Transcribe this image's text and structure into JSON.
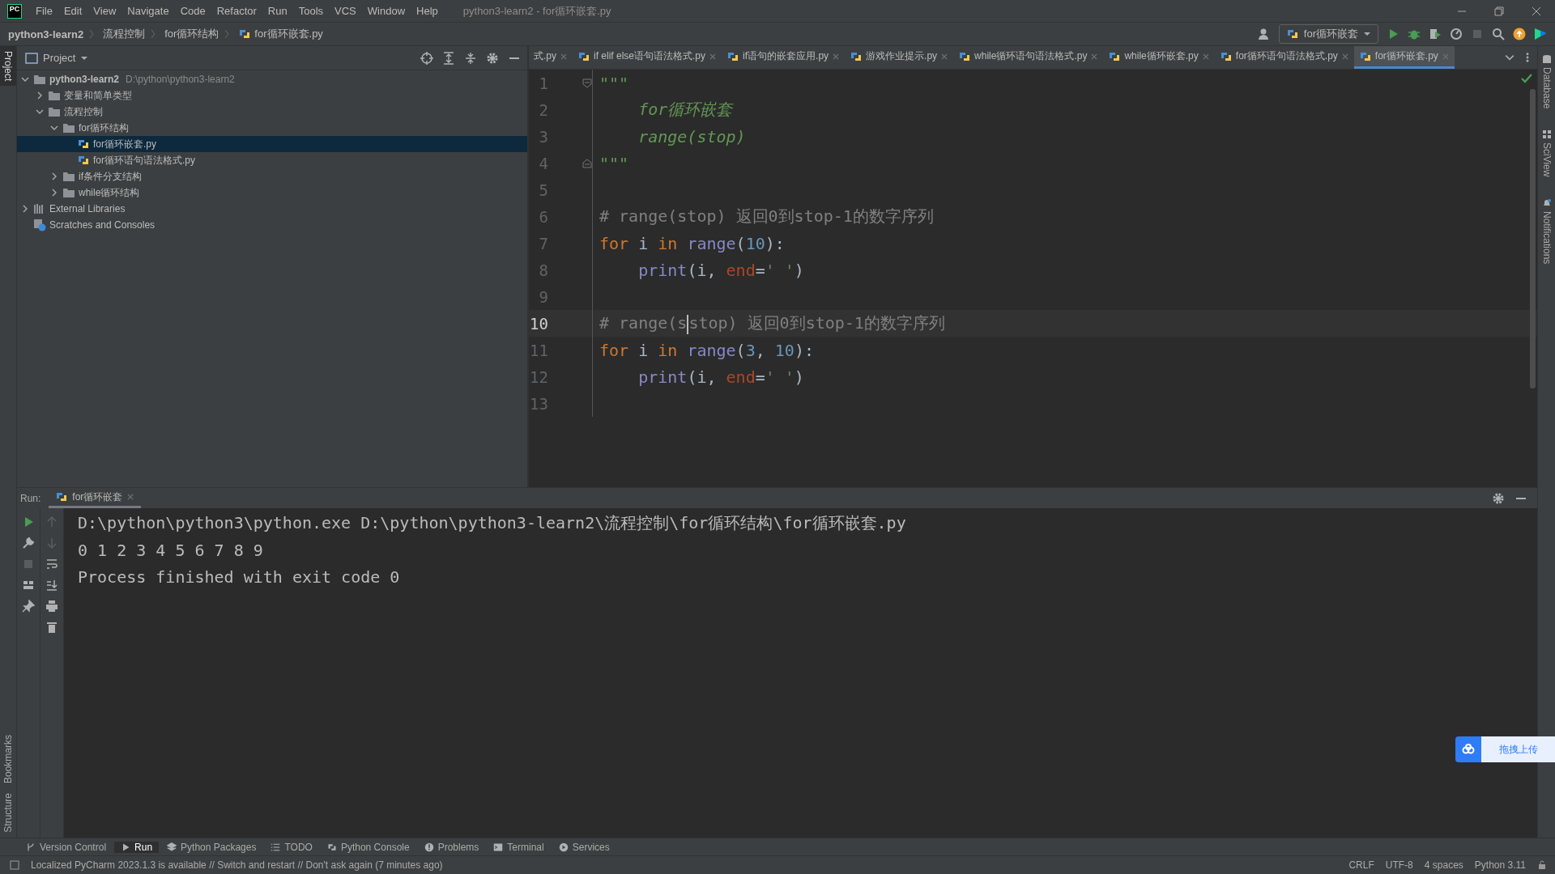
{
  "window": {
    "logo": "PC",
    "title": "python3-learn2 - for循环嵌套.py"
  },
  "menu": [
    "File",
    "Edit",
    "View",
    "Navigate",
    "Code",
    "Refactor",
    "Run",
    "Tools",
    "VCS",
    "Window",
    "Help"
  ],
  "breadcrumbs": [
    "python3-learn2",
    "流程控制",
    "for循环结构",
    "for循环嵌套.py"
  ],
  "run_config": "for循环嵌套",
  "left_strip": [
    {
      "label": "Project",
      "selected": true
    },
    {
      "label": "Bookmarks",
      "selected": false
    },
    {
      "label": "Structure",
      "selected": false
    }
  ],
  "right_strip": [
    {
      "label": "Database",
      "kind": "database"
    },
    {
      "label": "SciView",
      "kind": "sciview"
    },
    {
      "label": "Notifications",
      "kind": "notifications"
    }
  ],
  "project": {
    "title": "Project",
    "tree": [
      {
        "kind": "folder",
        "label": "python3-learn2",
        "path": "D:\\python\\python3-learn2",
        "expanded": true,
        "selected": false,
        "children": [
          {
            "kind": "folder",
            "label": "变量和简单类型",
            "expanded": false,
            "selected": false
          },
          {
            "kind": "folder",
            "label": "流程控制",
            "expanded": true,
            "selected": false,
            "children": [
              {
                "kind": "folder",
                "label": "for循环结构",
                "expanded": true,
                "selected": false,
                "children": [
                  {
                    "kind": "file",
                    "label": "for循环嵌套.py",
                    "selected": true
                  },
                  {
                    "kind": "file",
                    "label": "for循环语句语法格式.py",
                    "selected": false
                  }
                ]
              },
              {
                "kind": "folder",
                "label": "if条件分支结构",
                "expanded": false,
                "selected": false
              },
              {
                "kind": "folder",
                "label": "while循环结构",
                "expanded": false,
                "selected": false
              }
            ]
          }
        ]
      },
      {
        "kind": "library",
        "label": "External Libraries",
        "expanded": false,
        "selected": false
      },
      {
        "kind": "scratches",
        "label": "Scratches and Consoles",
        "selected": false
      }
    ]
  },
  "editor": {
    "tabs": [
      {
        "label": "式.py",
        "selected": false
      },
      {
        "label": "if elif else语句语法格式.py",
        "selected": false
      },
      {
        "label": "if语句的嵌套应用.py",
        "selected": false
      },
      {
        "label": "游戏作业提示.py",
        "selected": false
      },
      {
        "label": "while循环语句语法格式.py",
        "selected": false
      },
      {
        "label": "while循环嵌套.py",
        "selected": false
      },
      {
        "label": "for循环语句语法格式.py",
        "selected": false
      },
      {
        "label": "for循环嵌套.py",
        "selected": true
      }
    ],
    "lines": [
      {
        "number": "1",
        "current": false,
        "fold_open": true,
        "tokens": [
          {
            "kind": "docstring",
            "text": "\"\"\""
          }
        ]
      },
      {
        "number": "2",
        "current": false,
        "tokens": [
          {
            "kind": "docstring",
            "text": "    for循环嵌套"
          }
        ]
      },
      {
        "number": "3",
        "current": false,
        "tokens": [
          {
            "kind": "docstring",
            "text": "    range(stop)"
          }
        ]
      },
      {
        "number": "4",
        "current": false,
        "fold_close": true,
        "tokens": [
          {
            "kind": "docstring",
            "text": "\"\"\""
          }
        ]
      },
      {
        "number": "5",
        "current": false
      },
      {
        "number": "6",
        "current": false,
        "tokens": [
          {
            "kind": "comment",
            "text": "# range(stop) 返回0到stop-1的数字序列"
          }
        ]
      },
      {
        "number": "7",
        "current": false,
        "tokens": [
          {
            "kind": "keyword",
            "text": "for"
          },
          {
            "kind": "plain",
            "text": " i "
          },
          {
            "kind": "keyword",
            "text": "in"
          },
          {
            "kind": "builtin",
            "text": " range"
          },
          {
            "kind": "plain",
            "text": "("
          },
          {
            "kind": "number",
            "text": "10"
          },
          {
            "kind": "plain",
            "text": "):"
          }
        ]
      },
      {
        "number": "8",
        "current": false,
        "tokens": [
          {
            "kind": "builtin",
            "text": "    print"
          },
          {
            "kind": "plain",
            "text": "(i, "
          },
          {
            "kind": "param",
            "text": "end"
          },
          {
            "kind": "plain",
            "text": "="
          },
          {
            "kind": "string",
            "text": "' '"
          },
          {
            "kind": "plain",
            "text": ")"
          }
        ]
      },
      {
        "number": "9",
        "current": false
      },
      {
        "number": "10",
        "current": true,
        "tokens": [
          {
            "kind": "comment",
            "text": "# range(s"
          },
          {
            "kind": "caret"
          },
          {
            "kind": "comment",
            "text": "stop) 返回0到stop-1的数字序列"
          }
        ]
      },
      {
        "number": "11",
        "current": false,
        "tokens": [
          {
            "kind": "keyword",
            "text": "for"
          },
          {
            "kind": "plain",
            "text": " i "
          },
          {
            "kind": "keyword",
            "text": "in"
          },
          {
            "kind": "builtin",
            "text": " range"
          },
          {
            "kind": "plain",
            "text": "("
          },
          {
            "kind": "number",
            "text": "3"
          },
          {
            "kind": "plain",
            "text": ", "
          },
          {
            "kind": "number",
            "text": "10"
          },
          {
            "kind": "plain",
            "text": "):"
          }
        ]
      },
      {
        "number": "12",
        "current": false,
        "tokens": [
          {
            "kind": "builtin",
            "text": "    print"
          },
          {
            "kind": "plain",
            "text": "(i, "
          },
          {
            "kind": "param",
            "text": "end"
          },
          {
            "kind": "plain",
            "text": "="
          },
          {
            "kind": "string",
            "text": "' '"
          },
          {
            "kind": "plain",
            "text": ")"
          }
        ]
      },
      {
        "number": "13",
        "current": false
      }
    ]
  },
  "run": {
    "label": "Run:",
    "tabs": [
      {
        "label": "for循环嵌套",
        "selected": true
      }
    ],
    "toolbar": [
      {
        "kind": "rerun",
        "disabled": false
      },
      {
        "kind": "wrench",
        "disabled": false
      },
      {
        "kind": "stop",
        "disabled": true
      },
      {
        "kind": "layout",
        "disabled": false
      },
      {
        "kind": "pin",
        "disabled": false
      }
    ],
    "toolbar_2": [
      {
        "kind": "up",
        "disabled": true
      },
      {
        "kind": "down",
        "disabled": true
      },
      {
        "kind": "wrap",
        "disabled": false
      },
      {
        "kind": "scroll-end",
        "disabled": false
      },
      {
        "kind": "print",
        "disabled": false
      },
      {
        "kind": "trash",
        "disabled": false
      }
    ],
    "output": [
      "D:\\python\\python3\\python.exe D:\\python\\python3-learn2\\流程控制\\for循环结构\\for循环嵌套.py",
      "0 1 2 3 4 5 6 7 8 9",
      "Process finished with exit code 0"
    ]
  },
  "tool_windows": [
    {
      "kind": "vcs",
      "label": "Version Control",
      "selected": false
    },
    {
      "kind": "run",
      "label": "Run",
      "selected": true
    },
    {
      "kind": "packages",
      "label": "Python Packages",
      "selected": false
    },
    {
      "kind": "todo",
      "label": "TODO",
      "selected": false
    },
    {
      "kind": "console",
      "label": "Python Console",
      "selected": false
    },
    {
      "kind": "problems",
      "label": "Problems",
      "selected": false
    },
    {
      "kind": "terminal",
      "label": "Terminal",
      "selected": false
    },
    {
      "kind": "services",
      "label": "Services",
      "selected": false
    }
  ],
  "status_bar": {
    "message": "Localized PyCharm 2023.1.3 is available // Switch and restart // Don't ask again (7 minutes ago)",
    "items": [
      "CRLF",
      "UTF-8",
      "4 spaces",
      "Python 3.11"
    ]
  },
  "upload_button": {
    "label": "拖拽上传"
  }
}
